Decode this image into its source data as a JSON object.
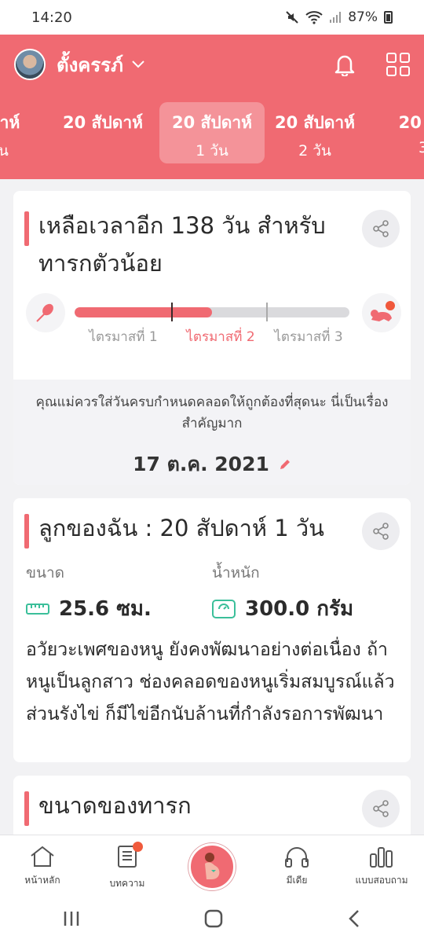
{
  "status_bar": {
    "time": "14:20",
    "battery": "87%"
  },
  "header": {
    "user_name": "ตั้งครรภ์",
    "icons": [
      "bell-icon",
      "grid-menu-icon"
    ],
    "week_tabs": [
      {
        "line1": "ปดาห์",
        "line2": "วัน"
      },
      {
        "line1": "20 สัปดาห์",
        "line2": ""
      },
      {
        "line1": "20 สัปดาห์",
        "line2": "1 วัน",
        "active": true
      },
      {
        "line1": "20 สัปดาห์",
        "line2": "2 วัน"
      },
      {
        "line1": "20 สับ",
        "line2": "3"
      }
    ]
  },
  "countdown_card": {
    "title": "เหลือเวลาอีก 138 วัน สำหรับทารกตัวน้อย",
    "progress_fraction": 0.5,
    "trimesters": [
      "ไตรมาสที่ 1",
      "ไตรมาสที่ 2",
      "ไตรมาสที่ 3"
    ],
    "active_trimester": 2,
    "due_note": "คุณแม่ควรใส่วันครบกำหนดคลอดให้ถูกต้องที่สุดนะ นี่เป็นเรื่องสำคัญมาก",
    "due_date": "17 ต.ค. 2021"
  },
  "baby_card": {
    "title": "ลูกของฉัน : 20 สัปดาห์ 1  วัน",
    "size_label": "ขนาด",
    "size_value": "25.6 ซม.",
    "weight_label": "น้ำหนัก",
    "weight_value": "300.0 กรัม",
    "description": "อวัยวะเพศของหนู ยังคงพัฒนาอย่างต่อเนื่อง ถ้าหนูเป็นลูกสาว ช่องคลอดของหนูเริ่มสมบูรณ์แล้ว ส่วนรังไข่ ก็มีไข่อีกนับล้านที่กำลังรอการพัฒนา"
  },
  "size_card": {
    "title": "ขนาดของทารก"
  },
  "bottom_nav": {
    "home": "หน้าหลัก",
    "articles": "บทความ",
    "media": "มีเดีย",
    "quiz": "แบบสอบถาม"
  },
  "colors": {
    "accent": "#f06a72",
    "badge": "#f05a3c"
  }
}
